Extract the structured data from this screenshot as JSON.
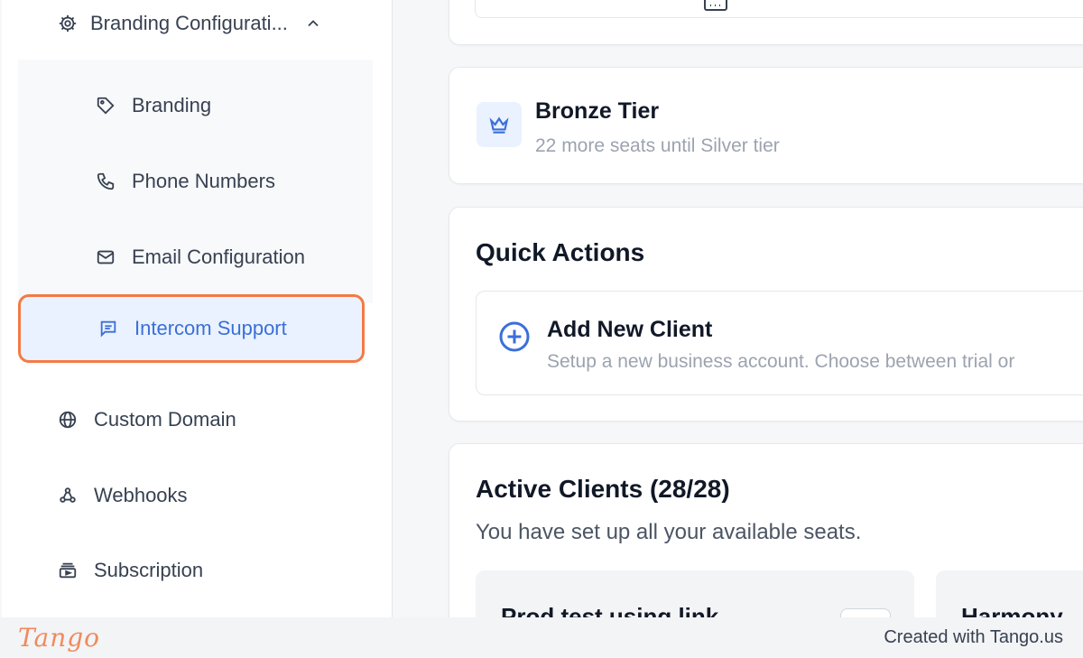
{
  "sidebar": {
    "group_header": {
      "label": "Branding Configurati...",
      "icon": "gear-icon",
      "expanded_icon": "chevron-up-icon"
    },
    "submenu": [
      {
        "label": "Branding",
        "icon": "tag-icon"
      },
      {
        "label": "Phone Numbers",
        "icon": "phone-icon"
      },
      {
        "label": "Email Configuration",
        "icon": "mail-icon"
      },
      {
        "label": "Intercom Support",
        "icon": "chat-icon",
        "active": true
      }
    ],
    "items": [
      {
        "label": "Custom Domain",
        "icon": "globe-icon"
      },
      {
        "label": "Webhooks",
        "icon": "webhook-icon"
      },
      {
        "label": "Subscription",
        "icon": "subscription-icon"
      }
    ]
  },
  "tier": {
    "title": "Bronze Tier",
    "subtitle": "22 more seats until Silver tier",
    "icon": "crown-icon"
  },
  "quick_actions": {
    "title": "Quick Actions",
    "add_client": {
      "title": "Add New Client",
      "description": "Setup a new business account. Choose between trial or",
      "icon": "plus-circle-icon"
    }
  },
  "active_clients": {
    "title": "Active Clients (28/28)",
    "subtitle": "You have set up all your available seats.",
    "clients": [
      {
        "name": "Prod test using link"
      },
      {
        "name": "Harmony"
      }
    ]
  },
  "footer": {
    "logo": "Tango",
    "credit": "Created with Tango.us"
  },
  "colors": {
    "accent": "#3b6fd8",
    "highlight_border": "#f47a45",
    "active_bg": "#eaf2ff"
  }
}
